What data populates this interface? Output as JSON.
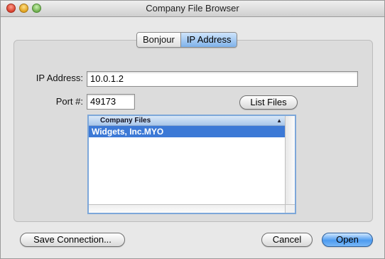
{
  "window": {
    "title": "Company File Browser",
    "accent_color": "#3c79d6"
  },
  "tabs": [
    {
      "label": "Bonjour",
      "selected": false
    },
    {
      "label": "IP Address",
      "selected": true
    }
  ],
  "form": {
    "ip_label": "IP Address:",
    "ip_value": "10.0.1.2",
    "port_label": "Port #:",
    "port_value": "49173",
    "list_files_label": "List Files"
  },
  "file_list": {
    "column_header": "Company Files",
    "sort_indicator": "▲",
    "rows": [
      "Widgets, Inc.MYO"
    ],
    "selected_index": 0
  },
  "footer": {
    "save_connection_label": "Save Connection...",
    "cancel_label": "Cancel",
    "open_label": "Open"
  }
}
